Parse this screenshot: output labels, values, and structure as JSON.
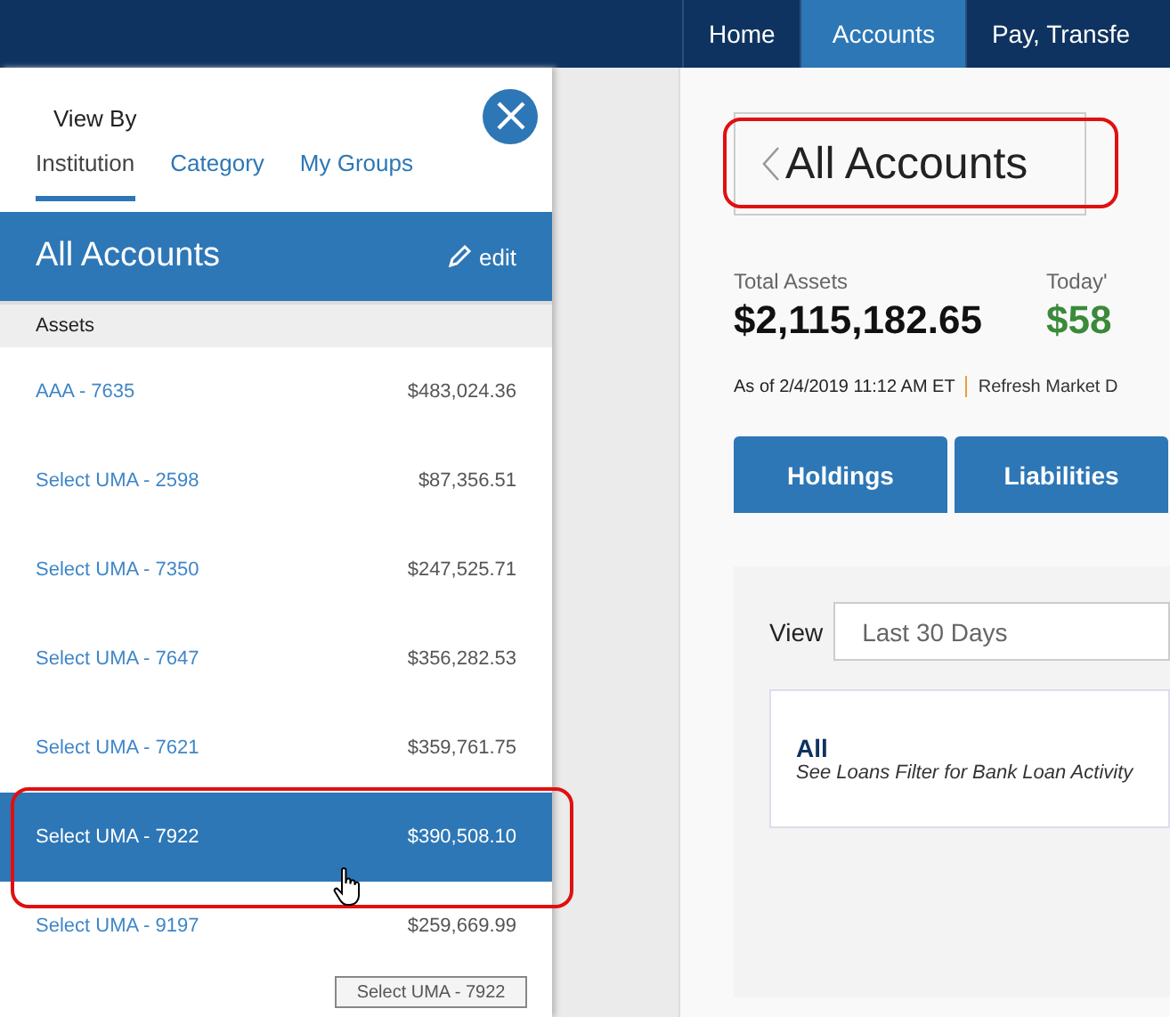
{
  "top_nav": {
    "items": [
      {
        "label": "Home",
        "selected": false
      },
      {
        "label": "Accounts",
        "selected": true
      },
      {
        "label": "Pay, Transfe",
        "selected": false
      }
    ]
  },
  "sidebar": {
    "view_by_label": "View By",
    "tabs": [
      {
        "label": "Institution",
        "selected": true
      },
      {
        "label": "Category",
        "selected": false
      },
      {
        "label": "My Groups",
        "selected": false
      }
    ],
    "header": {
      "title": "All Accounts",
      "edit_label": "edit"
    },
    "section": "Assets",
    "accounts": [
      {
        "name": "AAA - 7635",
        "amount": "$483,024.36",
        "selected": false
      },
      {
        "name": "Select UMA - 2598",
        "amount": "$87,356.51",
        "selected": false
      },
      {
        "name": "Select UMA - 7350",
        "amount": "$247,525.71",
        "selected": false
      },
      {
        "name": "Select UMA - 7647",
        "amount": "$356,282.53",
        "selected": false
      },
      {
        "name": "Select UMA - 7621",
        "amount": "$359,761.75",
        "selected": false
      },
      {
        "name": "Select UMA - 7922",
        "amount": "$390,508.10",
        "selected": true
      },
      {
        "name": "Select UMA - 9197",
        "amount": "$259,669.99",
        "selected": false
      }
    ],
    "tooltip": "Select UMA - 7922"
  },
  "main": {
    "back_title": "All Accounts",
    "summary": [
      {
        "label": "Total Assets",
        "value": "$2,115,182.65",
        "kind": "plain"
      },
      {
        "label": "Today'",
        "value": "$58",
        "kind": "gain"
      }
    ],
    "as_of": "As of  2/4/2019 11:12 AM ET",
    "refresh_link": "Refresh Market D",
    "tabs": [
      {
        "label": "Holdings"
      },
      {
        "label": "Liabilities"
      }
    ],
    "view_label": "View",
    "view_select": "Last 30 Days",
    "filter_card": {
      "title": "All",
      "subtitle": "See Loans Filter for Bank Loan Activity"
    }
  }
}
